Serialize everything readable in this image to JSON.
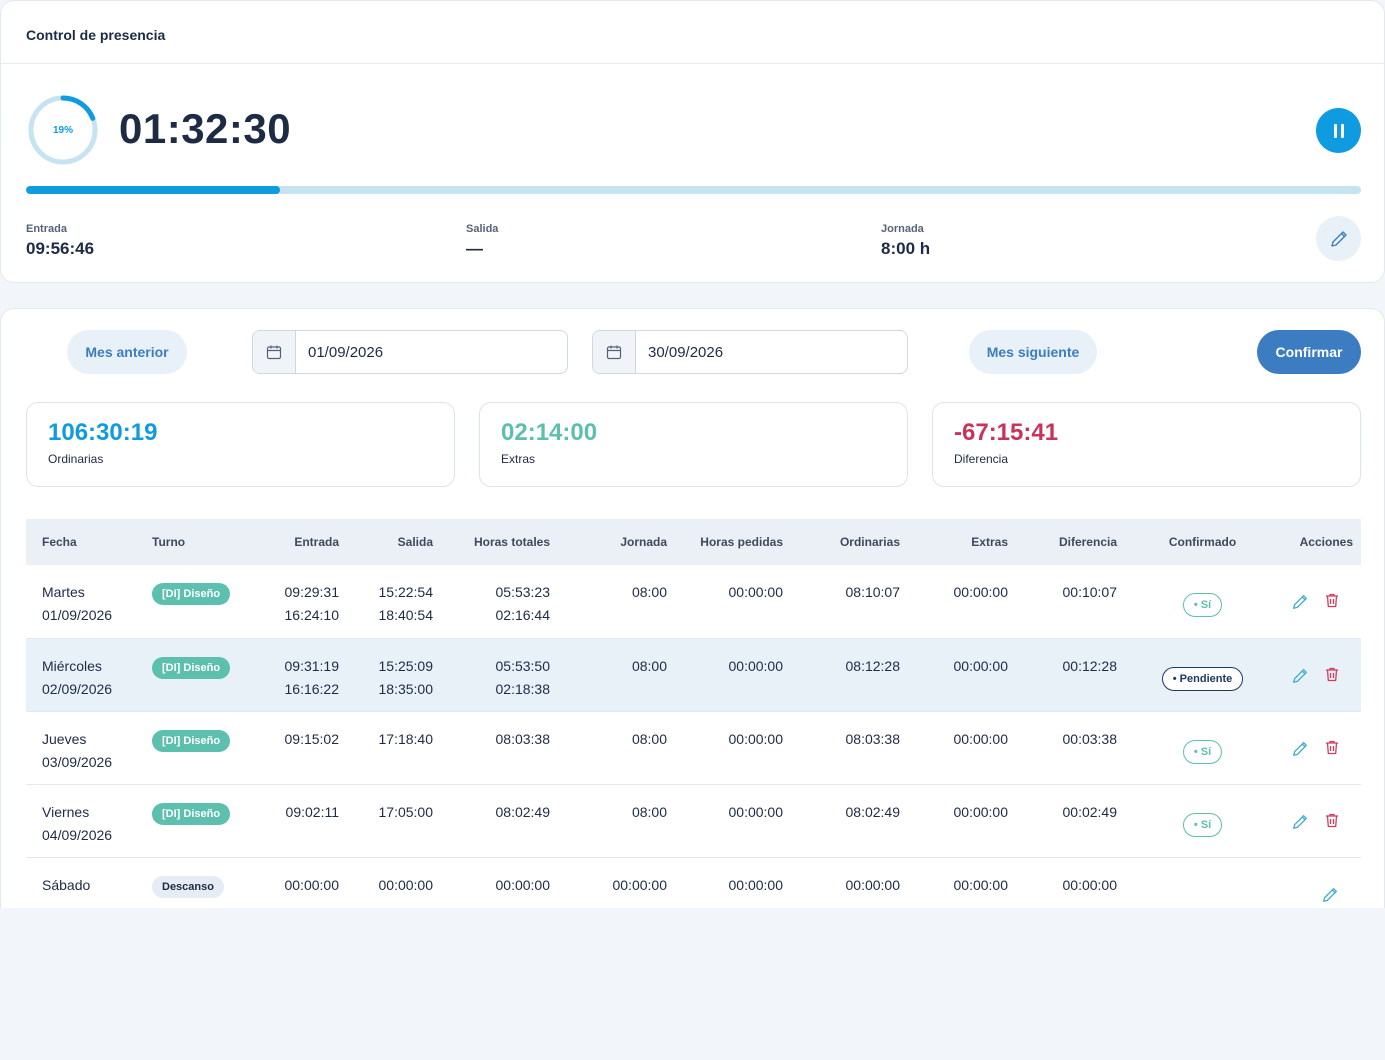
{
  "header": {
    "title": "Control de presencia"
  },
  "timer": {
    "percent_label": "19%",
    "progress": 0.19,
    "time": "01:32:30",
    "accent": "#0f9be0",
    "track": "#c6e3f2"
  },
  "stats": {
    "entrada_label": "Entrada",
    "entrada_value": "09:56:46",
    "salida_label": "Salida",
    "salida_value": "—",
    "jornada_label": "Jornada",
    "jornada_value": "8:00 h"
  },
  "filters": {
    "prev_month": "Mes anterior",
    "start_date": "01/09/2026",
    "end_date": "30/09/2026",
    "next_month": "Mes siguiente",
    "confirm": "Confirmar"
  },
  "summary": [
    {
      "value": "106:30:19",
      "label": "Ordinarias",
      "color": "#0f9be0"
    },
    {
      "value": "02:14:00",
      "label": "Extras",
      "color": "#5dbfad"
    },
    {
      "value": "-67:15:41",
      "label": "Diferencia",
      "color": "#c8335a"
    }
  ],
  "table": {
    "columns": [
      "Fecha",
      "Turno",
      "Entrada",
      "Salida",
      "Horas totales",
      "Jornada",
      "Horas pedidas",
      "Ordinarias",
      "Extras",
      "Diferencia",
      "Confirmado",
      "Acciones"
    ],
    "rows": [
      {
        "day": "Martes",
        "date": "01/09/2026",
        "turno": "[DI] Diseño",
        "entrada": "09:29:31",
        "entrada2": "16:24:10",
        "salida": "15:22:54",
        "salida2": "18:40:54",
        "total": "05:53:23",
        "total2": "02:16:44",
        "jornada": "08:00",
        "pedidas": "00:00:00",
        "ordinarias": "08:10:07",
        "extras": "00:00:00",
        "diferencia": "00:10:07",
        "confirmado": "Sí"
      },
      {
        "day": "Miércoles",
        "date": "02/09/2026",
        "turno": "[DI] Diseño",
        "entrada": "09:31:19",
        "entrada2": "16:16:22",
        "salida": "15:25:09",
        "salida2": "18:35:00",
        "total": "05:53:50",
        "total2": "02:18:38",
        "jornada": "08:00",
        "pedidas": "00:00:00",
        "ordinarias": "08:12:28",
        "extras": "00:00:00",
        "diferencia": "00:12:28",
        "confirmado": "Pendiente"
      },
      {
        "day": "Jueves",
        "date": "03/09/2026",
        "turno": "[DI] Diseño",
        "entrada": "09:15:02",
        "entrada2": "",
        "salida": "17:18:40",
        "salida2": "",
        "total": "08:03:38",
        "total2": "",
        "jornada": "08:00",
        "pedidas": "00:00:00",
        "ordinarias": "08:03:38",
        "extras": "00:00:00",
        "diferencia": "00:03:38",
        "confirmado": "Sí"
      },
      {
        "day": "Viernes",
        "date": "04/09/2026",
        "turno": "[DI] Diseño",
        "entrada": "09:02:11",
        "entrada2": "",
        "salida": "17:05:00",
        "salida2": "",
        "total": "08:02:49",
        "total2": "",
        "jornada": "08:00",
        "pedidas": "00:00:00",
        "ordinarias": "08:02:49",
        "extras": "00:00:00",
        "diferencia": "00:02:49",
        "confirmado": "Sí"
      },
      {
        "day": "Sábado",
        "date": "",
        "turno": "Descanso",
        "entrada": "00:00:00",
        "entrada2": "",
        "salida": "00:00:00",
        "salida2": "",
        "total": "00:00:00",
        "total2": "",
        "jornada": "00:00:00",
        "pedidas": "00:00:00",
        "ordinarias": "00:00:00",
        "extras": "00:00:00",
        "diferencia": "00:00:00",
        "confirmado": ""
      }
    ]
  }
}
